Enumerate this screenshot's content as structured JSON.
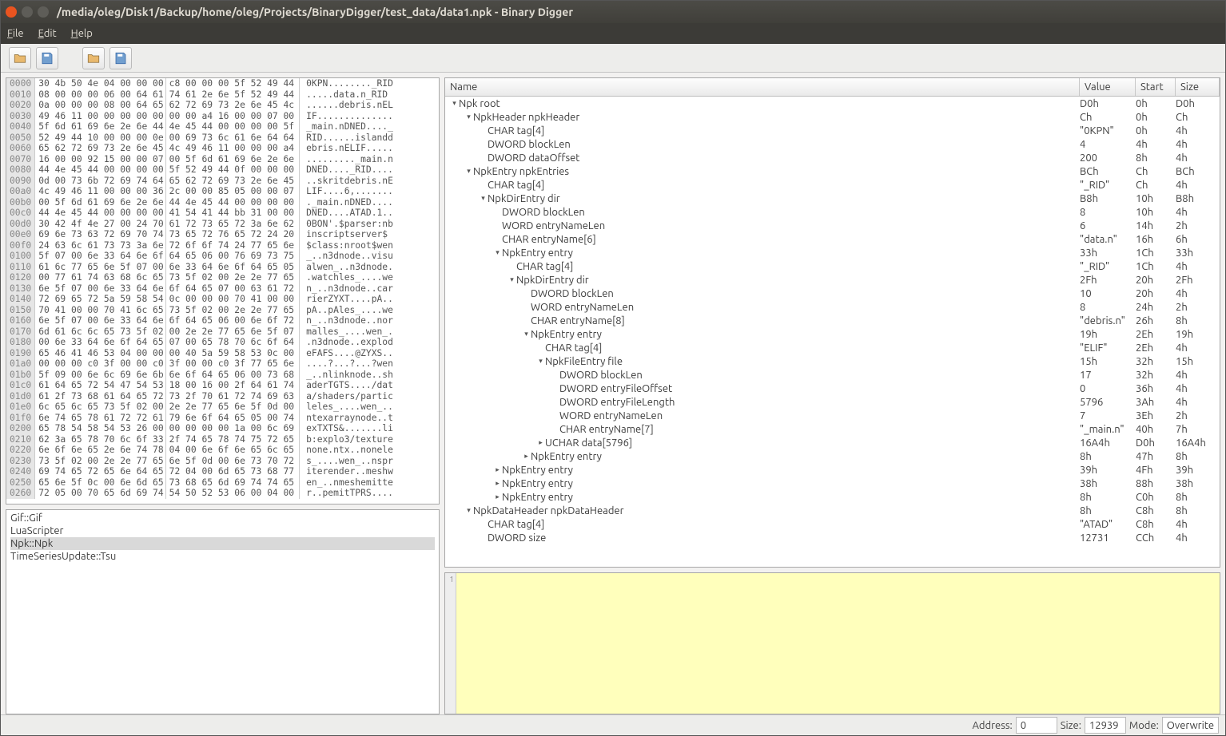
{
  "title": "/media/oleg/Disk1/Backup/home/oleg/Projects/BinaryDigger/test_data/data1.npk - Binary Digger",
  "menu": [
    "File",
    "Edit",
    "Help"
  ],
  "hex": [
    {
      "o": "0000",
      "a": "30 4b 50 4e 04 00 00 00",
      "b": "c8 00 00 00 5f 52 49 44",
      "t": "0KPN........_RID"
    },
    {
      "o": "0010",
      "a": "08 00 00 00 06 00 64 61",
      "b": "74 61 2e 6e 5f 52 49 44",
      "t": ".....data.n_RID"
    },
    {
      "o": "0020",
      "a": "0a 00 00 00 08 00 64 65",
      "b": "62 72 69 73 2e 6e 45 4c",
      "t": "......debris.nEL"
    },
    {
      "o": "0030",
      "a": "49 46 11 00 00 00 00 00",
      "b": "00 00 a4 16 00 00 07 00",
      "t": "IF.............."
    },
    {
      "o": "0040",
      "a": "5f 6d 61 69 6e 2e 6e 44",
      "b": "4e 45 44 00 00 00 00 5f",
      "t": "_main.nDNED...._"
    },
    {
      "o": "0050",
      "a": "52 49 44 10 00 00 00 0e",
      "b": "00 69 73 6c 61 6e 64 64",
      "t": "RID......islandd"
    },
    {
      "o": "0060",
      "a": "65 62 72 69 73 2e 6e 45",
      "b": "4c 49 46 11 00 00 00 a4",
      "t": "ebris.nELIF....."
    },
    {
      "o": "0070",
      "a": "16 00 00 92 15 00 00 07",
      "b": "00 5f 6d 61 69 6e 2e 6e",
      "t": "........._main.n"
    },
    {
      "o": "0080",
      "a": "44 4e 45 44 00 00 00 00",
      "b": "5f 52 49 44 0f 00 00 00",
      "t": "DNED...._RID...."
    },
    {
      "o": "0090",
      "a": "0d 00 73 6b 72 69 74 64",
      "b": "65 62 72 69 73 2e 6e 45",
      "t": "..skritdebris.nE"
    },
    {
      "o": "00a0",
      "a": "4c 49 46 11 00 00 00 36",
      "b": "2c 00 00 85 05 00 00 07",
      "t": "LIF....6,......."
    },
    {
      "o": "00b0",
      "a": "00 5f 6d 61 69 6e 2e 6e",
      "b": "44 4e 45 44 00 00 00 00",
      "t": "._main.nDNED...."
    },
    {
      "o": "00c0",
      "a": "44 4e 45 44 00 00 00 00",
      "b": "41 54 41 44 bb 31 00 00",
      "t": "DNED....ATAD.1.."
    },
    {
      "o": "00d0",
      "a": "30 42 4f 4e 27 00 24 70",
      "b": "61 72 73 65 72 3a 6e 62",
      "t": "0BON'.$parser:nb"
    },
    {
      "o": "00e0",
      "a": "69 6e 73 63 72 69 70 74",
      "b": "73 65 72 76 65 72 24 20",
      "t": "inscriptserver$ "
    },
    {
      "o": "00f0",
      "a": "24 63 6c 61 73 73 3a 6e",
      "b": "72 6f 6f 74 24 77 65 6e",
      "t": "$class:nroot$wen"
    },
    {
      "o": "0100",
      "a": "5f 07 00 6e 33 64 6e 6f",
      "b": "64 65 06 00 76 69 73 75",
      "t": "_..n3dnode..visu"
    },
    {
      "o": "0110",
      "a": "61 6c 77 65 6e 5f 07 00",
      "b": "6e 33 64 6e 6f 64 65 05",
      "t": "alwen_..n3dnode."
    },
    {
      "o": "0120",
      "a": "00 77 61 74 63 68 6c 65",
      "b": "73 5f 02 00 2e 2e 77 65",
      "t": ".watchles_....we"
    },
    {
      "o": "0130",
      "a": "6e 5f 07 00 6e 33 64 6e",
      "b": "6f 64 65 07 00 63 61 72",
      "t": "n_..n3dnode..car"
    },
    {
      "o": "0140",
      "a": "72 69 65 72 5a 59 58 54",
      "b": "0c 00 00 00 70 41 00 00",
      "t": "rierZYXT....pA.."
    },
    {
      "o": "0150",
      "a": "70 41 00 00 70 41 6c 65",
      "b": "73 5f 02 00 2e 2e 77 65",
      "t": "pA..pAles_....we"
    },
    {
      "o": "0160",
      "a": "6e 5f 07 00 6e 33 64 6e",
      "b": "6f 64 65 06 00 6e 6f 72",
      "t": "n_..n3dnode..nor"
    },
    {
      "o": "0170",
      "a": "6d 61 6c 6c 65 73 5f 02",
      "b": "00 2e 2e 77 65 6e 5f 07",
      "t": "malles_....wen_."
    },
    {
      "o": "0180",
      "a": "00 6e 33 64 6e 6f 64 65",
      "b": "07 00 65 78 70 6c 6f 64",
      "t": ".n3dnode..explod"
    },
    {
      "o": "0190",
      "a": "65 46 41 46 53 04 00 00",
      "b": "00 40 5a 59 58 53 0c 00",
      "t": "eFAFS....@ZYXS.."
    },
    {
      "o": "01a0",
      "a": "00 00 00 c0 3f 00 00 c0",
      "b": "3f 00 00 c0 3f 77 65 6e",
      "t": "....?...?...?wen"
    },
    {
      "o": "01b0",
      "a": "5f 09 00 6e 6c 69 6e 6b",
      "b": "6e 6f 64 65 06 00 73 68",
      "t": "_..nlinknode..sh"
    },
    {
      "o": "01c0",
      "a": "61 64 65 72 54 47 54 53",
      "b": "18 00 16 00 2f 64 61 74",
      "t": "aderTGTS..../dat"
    },
    {
      "o": "01d0",
      "a": "61 2f 73 68 61 64 65 72",
      "b": "73 2f 70 61 72 74 69 63",
      "t": "a/shaders/partic"
    },
    {
      "o": "01e0",
      "a": "6c 65 6c 65 73 5f 02 00",
      "b": "2e 2e 77 65 6e 5f 0d 00",
      "t": "leles_....wen_.."
    },
    {
      "o": "01f0",
      "a": "6e 74 65 78 61 72 72 61",
      "b": "79 6e 6f 64 65 05 00 74",
      "t": "ntexarraynode..t"
    },
    {
      "o": "0200",
      "a": "65 78 54 58 54 53 26 00",
      "b": "00 00 00 00 1a 00 6c 69",
      "t": "exTXTS&.......li"
    },
    {
      "o": "0210",
      "a": "62 3a 65 78 70 6c 6f 33",
      "b": "2f 74 65 78 74 75 72 65",
      "t": "b:explo3/texture"
    },
    {
      "o": "0220",
      "a": "6e 6f 6e 65 2e 6e 74 78",
      "b": "04 00 6e 6f 6e 65 6c 65",
      "t": "none.ntx..nonele"
    },
    {
      "o": "0230",
      "a": "73 5f 02 00 2e 2e 77 65",
      "b": "6e 5f 0d 00 6e 73 70 72",
      "t": "s_....wen_..nspr"
    },
    {
      "o": "0240",
      "a": "69 74 65 72 65 6e 64 65",
      "b": "72 04 00 6d 65 73 68 77",
      "t": "iterender..meshw"
    },
    {
      "o": "0250",
      "a": "65 6e 5f 0c 00 6e 6d 65",
      "b": "73 68 65 6d 69 74 74 65",
      "t": "en_..nmeshemitte"
    },
    {
      "o": "0260",
      "a": "72 05 00 70 65 6d 69 74",
      "b": "54 50 52 53 06 00 04 00",
      "t": "r..pemitTPRS...."
    }
  ],
  "plugins": [
    "Gif::Gif",
    "LuaScripter",
    "Npk::Npk",
    "TimeSeriesUpdate::Tsu"
  ],
  "plugin_sel": 2,
  "tree_hdr": [
    "Name",
    "Value",
    "Start",
    "Size"
  ],
  "tree": [
    {
      "d": 0,
      "a": "▾",
      "n": "Npk root",
      "v": "D0h",
      "s": "0h",
      "z": "D0h"
    },
    {
      "d": 1,
      "a": "▾",
      "n": "NpkHeader npkHeader",
      "v": "Ch",
      "s": "0h",
      "z": "Ch"
    },
    {
      "d": 2,
      "a": "",
      "n": "CHAR tag[4]",
      "v": "\"0KPN\"",
      "s": "0h",
      "z": "4h"
    },
    {
      "d": 2,
      "a": "",
      "n": "DWORD blockLen",
      "v": "4",
      "s": "4h",
      "z": "4h"
    },
    {
      "d": 2,
      "a": "",
      "n": "DWORD dataOffset",
      "v": "200",
      "s": "8h",
      "z": "4h"
    },
    {
      "d": 1,
      "a": "▾",
      "n": "NpkEntry npkEntries",
      "v": "BCh",
      "s": "Ch",
      "z": "BCh"
    },
    {
      "d": 2,
      "a": "",
      "n": "CHAR tag[4]",
      "v": "\"_RID\"",
      "s": "Ch",
      "z": "4h"
    },
    {
      "d": 2,
      "a": "▾",
      "n": "NpkDirEntry dir",
      "v": "B8h",
      "s": "10h",
      "z": "B8h"
    },
    {
      "d": 3,
      "a": "",
      "n": "DWORD blockLen",
      "v": "8",
      "s": "10h",
      "z": "4h"
    },
    {
      "d": 3,
      "a": "",
      "n": "WORD entryNameLen",
      "v": "6",
      "s": "14h",
      "z": "2h"
    },
    {
      "d": 3,
      "a": "",
      "n": "CHAR entryName[6]",
      "v": "\"data.n\"",
      "s": "16h",
      "z": "6h"
    },
    {
      "d": 3,
      "a": "▾",
      "n": "NpkEntry entry",
      "v": "33h",
      "s": "1Ch",
      "z": "33h"
    },
    {
      "d": 4,
      "a": "",
      "n": "CHAR tag[4]",
      "v": "\"_RID\"",
      "s": "1Ch",
      "z": "4h"
    },
    {
      "d": 4,
      "a": "▾",
      "n": "NpkDirEntry dir",
      "v": "2Fh",
      "s": "20h",
      "z": "2Fh"
    },
    {
      "d": 5,
      "a": "",
      "n": "DWORD blockLen",
      "v": "10",
      "s": "20h",
      "z": "4h"
    },
    {
      "d": 5,
      "a": "",
      "n": "WORD entryNameLen",
      "v": "8",
      "s": "24h",
      "z": "2h"
    },
    {
      "d": 5,
      "a": "",
      "n": "CHAR entryName[8]",
      "v": "\"debris.n\"",
      "s": "26h",
      "z": "8h"
    },
    {
      "d": 5,
      "a": "▾",
      "n": "NpkEntry entry",
      "v": "19h",
      "s": "2Eh",
      "z": "19h"
    },
    {
      "d": 6,
      "a": "",
      "n": "CHAR tag[4]",
      "v": "\"ELIF\"",
      "s": "2Eh",
      "z": "4h"
    },
    {
      "d": 6,
      "a": "▾",
      "n": "NpkFileEntry file",
      "v": "15h",
      "s": "32h",
      "z": "15h"
    },
    {
      "d": 7,
      "a": "",
      "n": "DWORD blockLen",
      "v": "17",
      "s": "32h",
      "z": "4h"
    },
    {
      "d": 7,
      "a": "",
      "n": "DWORD entryFileOffset",
      "v": "0",
      "s": "36h",
      "z": "4h"
    },
    {
      "d": 7,
      "a": "",
      "n": "DWORD entryFileLength",
      "v": "5796",
      "s": "3Ah",
      "z": "4h"
    },
    {
      "d": 7,
      "a": "",
      "n": "WORD entryNameLen",
      "v": "7",
      "s": "3Eh",
      "z": "2h"
    },
    {
      "d": 7,
      "a": "",
      "n": "CHAR entryName[7]",
      "v": "\"_main.n\"",
      "s": "40h",
      "z": "7h"
    },
    {
      "d": 6,
      "a": "▸",
      "n": "UCHAR data[5796]",
      "v": "16A4h",
      "s": "D0h",
      "z": "16A4h"
    },
    {
      "d": 5,
      "a": "▸",
      "n": "NpkEntry entry",
      "v": "8h",
      "s": "47h",
      "z": "8h"
    },
    {
      "d": 3,
      "a": "▸",
      "n": "NpkEntry entry",
      "v": "39h",
      "s": "4Fh",
      "z": "39h"
    },
    {
      "d": 3,
      "a": "▸",
      "n": "NpkEntry entry",
      "v": "38h",
      "s": "88h",
      "z": "38h"
    },
    {
      "d": 3,
      "a": "▸",
      "n": "NpkEntry entry",
      "v": "8h",
      "s": "C0h",
      "z": "8h"
    },
    {
      "d": 1,
      "a": "▾",
      "n": "NpkDataHeader npkDataHeader",
      "v": "8h",
      "s": "C8h",
      "z": "8h"
    },
    {
      "d": 2,
      "a": "",
      "n": "CHAR tag[4]",
      "v": "\"ATAD\"",
      "s": "C8h",
      "z": "4h"
    },
    {
      "d": 2,
      "a": "",
      "n": "DWORD size",
      "v": "12731",
      "s": "CCh",
      "z": "4h"
    }
  ],
  "output_line": "1",
  "status": {
    "addr_l": "Address:",
    "addr_v": "0",
    "size_l": "Size:",
    "size_v": "12939",
    "mode_l": "Mode:",
    "mode_v": "Overwrite"
  }
}
